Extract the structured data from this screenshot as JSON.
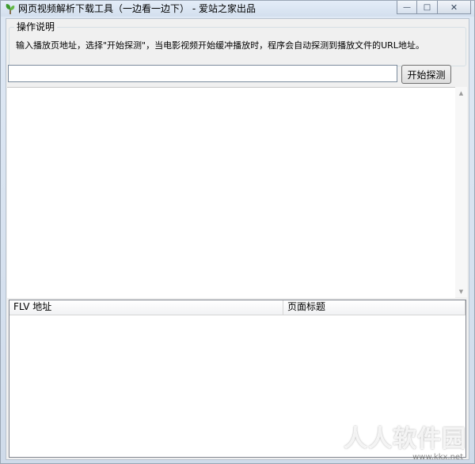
{
  "window": {
    "title": "网页视频解析下载工具（一边看一边下） - 爱站之家出品",
    "icon": "app-leaf-icon",
    "controls": {
      "minimize": "—",
      "maximize": "□",
      "close": "✕"
    }
  },
  "instructions": {
    "legend": "操作说明",
    "text": "输入播放页地址，选择\"开始探测\"，当电影视频开始缓冲播放时，程序会自动探测到播放文件的URL地址。"
  },
  "url_input": {
    "value": "",
    "placeholder": ""
  },
  "start_button": {
    "label": "开始探测"
  },
  "log_area": {
    "text": ""
  },
  "scrollbar": {
    "up_glyph": "▲",
    "down_glyph": "▼"
  },
  "result_list": {
    "columns": [
      "FLV 地址",
      "页面标题"
    ],
    "rows": []
  },
  "watermark": {
    "main": "人人软件园",
    "url": "www.kkx.net"
  },
  "colors": {
    "window_frame": "#dfe9f5",
    "client_bg": "#f0f0f0"
  }
}
